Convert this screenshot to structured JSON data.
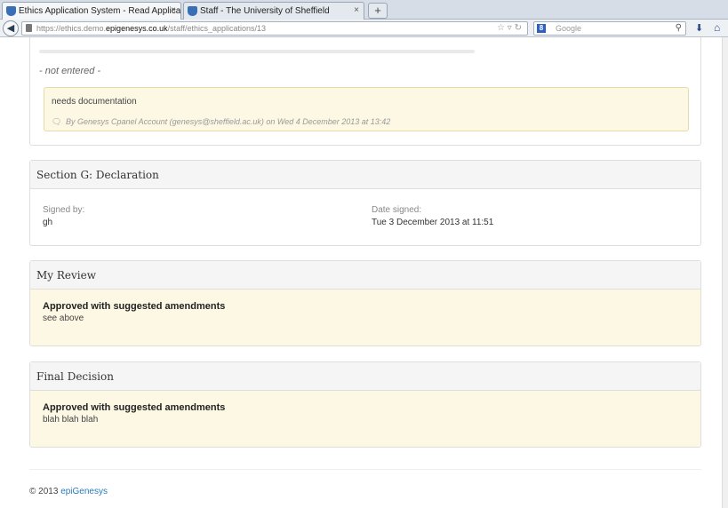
{
  "browser": {
    "tabs": [
      {
        "label": "Ethics Application System - Read Applicat...",
        "active": true
      },
      {
        "label": "Staff - The University of Sheffield",
        "active": false
      }
    ],
    "new_tab_label": "+",
    "tab_close_label": "×",
    "url_prefix": "https://ethics.demo.",
    "url_domain": "epigenesys.co.uk",
    "url_path": "/staff/ethics_applications/13",
    "search_placeholder": "Google",
    "search_engine_badge": "8"
  },
  "section_previous": {
    "value": "- not entered -",
    "comment": {
      "text": "needs documentation",
      "meta": "By Genesys Cpanel Account (genesys@sheffield.ac.uk) on Wed 4 December 2013 at 13:42"
    }
  },
  "section_g": {
    "title": "Section G: Declaration",
    "signed_by_label": "Signed by:",
    "signed_by_value": "gh",
    "date_signed_label": "Date signed:",
    "date_signed_value": "Tue 3 December 2013 at 11:51"
  },
  "my_review": {
    "title": "My Review",
    "decision": "Approved with suggested amendments",
    "comment": "see above"
  },
  "final_decision": {
    "title": "Final Decision",
    "decision": "Approved with suggested amendments",
    "comment": "blah blah blah"
  },
  "footer": {
    "copyright": "© 2013",
    "link_label": "epiGenesys"
  },
  "icons": [
    "shield-favicon-icon",
    "back-arrow-icon",
    "lock-icon",
    "star-icon",
    "reload-icon",
    "search-icon",
    "download-icon",
    "home-icon",
    "comment-bubble-icon"
  ]
}
